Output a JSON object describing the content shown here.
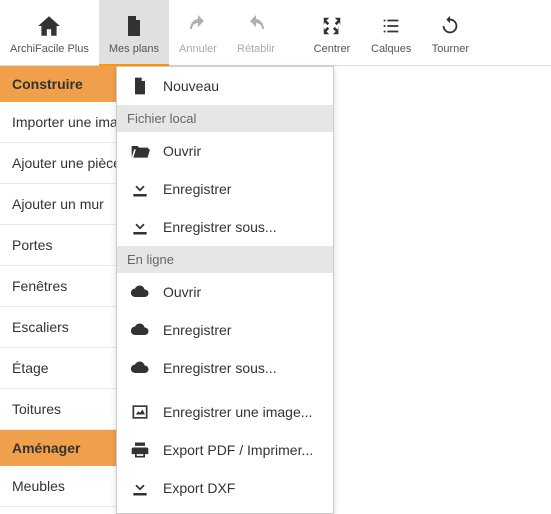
{
  "toolbar": {
    "items": [
      {
        "label": "ArchiFacile Plus"
      },
      {
        "label": "Mes plans"
      },
      {
        "label": "Annuler"
      },
      {
        "label": "Rétablir"
      },
      {
        "label": "Centrer"
      },
      {
        "label": "Calques"
      },
      {
        "label": "Tourner"
      }
    ]
  },
  "sidebar": {
    "construire_header": "Construire",
    "construire_items": [
      "Importer une image",
      "Ajouter une pièce",
      "Ajouter un mur",
      "Portes",
      "Fenêtres",
      "Escaliers",
      "Étage",
      "Toitures"
    ],
    "amenager_header": "Aménager",
    "amenager_items": [
      "Meubles"
    ]
  },
  "dropdown": {
    "nouveau": "Nouveau",
    "section_local": "Fichier local",
    "local_ouvrir": "Ouvrir",
    "local_enregistrer": "Enregistrer",
    "local_enregistrer_sous": "Enregistrer sous...",
    "section_enligne": "En ligne",
    "enligne_ouvrir": "Ouvrir",
    "enligne_enregistrer": "Enregistrer",
    "enligne_enregistrer_sous": "Enregistrer sous...",
    "enregistrer_image": "Enregistrer une image...",
    "export_pdf": "Export PDF / Imprimer...",
    "export_dxf": "Export DXF"
  }
}
